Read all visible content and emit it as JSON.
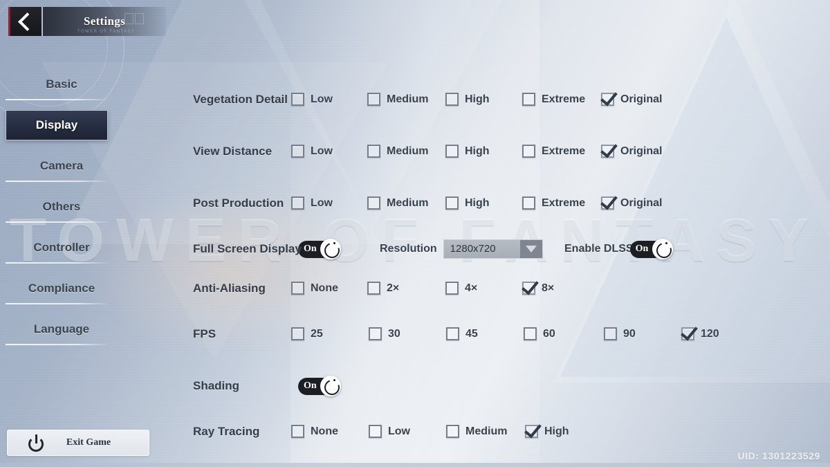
{
  "header": {
    "back_icon": "chevron-left-icon",
    "title": "Settings",
    "plate_subtitle": "TOWER OF FANTASY"
  },
  "watermark": "TOWER OF FANTASY",
  "sidebar": {
    "items": [
      {
        "label": "Basic",
        "active": false
      },
      {
        "label": "Display",
        "active": true
      },
      {
        "label": "Camera",
        "active": false
      },
      {
        "label": "Others",
        "active": false
      },
      {
        "label": "Controller",
        "active": false
      },
      {
        "label": "Compliance",
        "active": false
      },
      {
        "label": "Language",
        "active": false
      }
    ]
  },
  "settings": {
    "rows": [
      {
        "label": "Vegetation Detail",
        "type": "checkboxes",
        "options": [
          {
            "label": "Low",
            "checked": false
          },
          {
            "label": "Medium",
            "checked": false
          },
          {
            "label": "High",
            "checked": false
          },
          {
            "label": "Extreme",
            "checked": false
          },
          {
            "label": "Original",
            "checked": true
          }
        ]
      },
      {
        "label": "View Distance",
        "type": "checkboxes",
        "options": [
          {
            "label": "Low",
            "checked": false
          },
          {
            "label": "Medium",
            "checked": false
          },
          {
            "label": "High",
            "checked": false
          },
          {
            "label": "Extreme",
            "checked": false
          },
          {
            "label": "Original",
            "checked": true
          }
        ]
      },
      {
        "label": "Post Production",
        "type": "checkboxes",
        "options": [
          {
            "label": "Low",
            "checked": false
          },
          {
            "label": "Medium",
            "checked": false
          },
          {
            "label": "High",
            "checked": false
          },
          {
            "label": "Extreme",
            "checked": false
          },
          {
            "label": "Original",
            "checked": true
          }
        ]
      },
      {
        "label": "Anti-Aliasing",
        "type": "checkboxes",
        "options": [
          {
            "label": "None",
            "checked": false
          },
          {
            "label": "2×",
            "checked": false
          },
          {
            "label": "4×",
            "checked": false
          },
          {
            "label": "8×",
            "checked": true
          }
        ]
      },
      {
        "label": "FPS",
        "type": "checkboxes",
        "options": [
          {
            "label": "25",
            "checked": false
          },
          {
            "label": "30",
            "checked": false
          },
          {
            "label": "45",
            "checked": false
          },
          {
            "label": "60",
            "checked": false
          },
          {
            "label": "90",
            "checked": false
          },
          {
            "label": "120",
            "checked": true
          }
        ]
      },
      {
        "label": "Ray Tracing",
        "type": "checkboxes",
        "options": [
          {
            "label": "None",
            "checked": false
          },
          {
            "label": "Low",
            "checked": false
          },
          {
            "label": "Medium",
            "checked": false
          },
          {
            "label": "High",
            "checked": true
          }
        ]
      }
    ],
    "full_screen": {
      "label": "Full Screen Display",
      "state": "On"
    },
    "resolution": {
      "label": "Resolution",
      "value": "1280x720",
      "arrow_icon": "chevron-down-icon"
    },
    "dlss": {
      "label": "Enable DLSS",
      "state": "On"
    },
    "shading": {
      "label": "Shading",
      "state": "On"
    }
  },
  "footer": {
    "exit_label": "Exit Game",
    "power_icon": "power-icon",
    "uid": "UID: 1301223529"
  }
}
